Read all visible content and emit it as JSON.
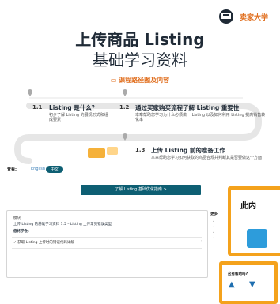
{
  "hero": {
    "brand_text": "卖家大学",
    "title_line1": "上传商品 Listing",
    "title_line2": "基础学习资料",
    "roadmap_label": "课程路径图及内容",
    "steps": [
      {
        "num": "1.1",
        "title": "Listing 是什么？",
        "desc": "初步了解 Listing 的展现形式和组成要素"
      },
      {
        "num": "1.2",
        "title": "通过买家购买流程了解 Listing 重要性",
        "desc": "本章帮助您学习为什么必须做一 Listing 以及如何利用 Listing 提高销售转化率"
      },
      {
        "num": "1.3",
        "title": "上传 Listing 前的准备工作",
        "desc": "本章帮助您学习如何获取的商品合规并判断其是否要做这个方面"
      }
    ]
  },
  "language": {
    "label": "查看:",
    "english": "English",
    "chinese": "中文"
  },
  "cta": {
    "label": "了解 Listing 基础优化指南 >"
  },
  "card": {
    "caption": "模块",
    "title": "上传 Listing 的基础学习资料 1.5 – Listing 上传常见错误类型",
    "section": "您将学会:",
    "item": "✓ 获取 Listing 上传时的错误代码详解"
  },
  "sidebar": {
    "heading": "更多"
  },
  "popup_big": {
    "title": "此内"
  },
  "popup_small": {
    "title": "这有帮助吗?"
  },
  "colors": {
    "accent": "#0e5f73",
    "orange": "#e06d1c",
    "highlight": "#f4a21c",
    "thumb": "#2d9cdb"
  }
}
